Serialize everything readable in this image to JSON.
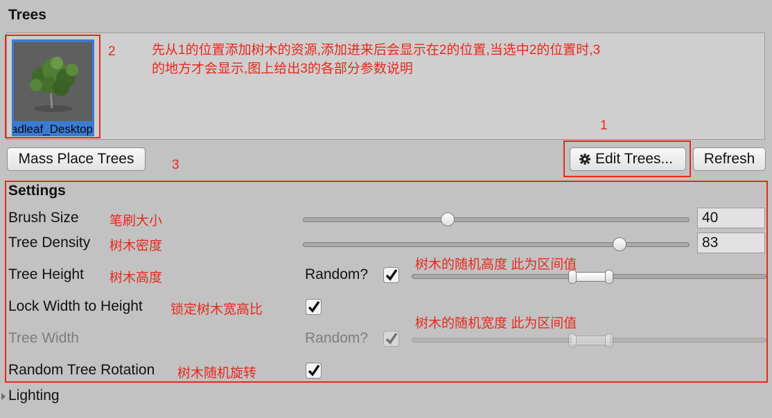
{
  "header": {
    "title": "Trees"
  },
  "tree_list": {
    "items": [
      {
        "name": "Broadleaf_Desktop",
        "selected": true,
        "icon": "tree-thumbnail"
      }
    ]
  },
  "buttons": {
    "mass_place": "Mass Place Trees",
    "edit_trees": "Edit Trees...",
    "edit_trees_icon": "gear-icon",
    "refresh": "Refresh"
  },
  "settings": {
    "title": "Settings",
    "brush_size": {
      "label": "Brush Size",
      "value": "40",
      "fraction": 0.37
    },
    "tree_density": {
      "label": "Tree Density",
      "value": "83",
      "fraction": 0.83
    },
    "tree_height": {
      "label": "Tree Height",
      "random_label": "Random?",
      "random_checked": true,
      "range": [
        0.45,
        0.56
      ]
    },
    "lock_width": {
      "label": "Lock Width to Height",
      "checked": true
    },
    "tree_width": {
      "label": "Tree Width",
      "random_label": "Random?",
      "random_checked": true,
      "disabled": true,
      "range": [
        0.45,
        0.56
      ]
    },
    "random_rotation": {
      "label": "Random Tree Rotation",
      "checked": true
    }
  },
  "lighting": {
    "label": "Lighting"
  },
  "annotations": {
    "marker_1": "1",
    "marker_2": "2",
    "marker_3": "3",
    "top_note_line1": "先从1的位置添加树木的资源,添加进来后会显示在2的位置,当选中2的位置时,3",
    "top_note_line2": "的地方才会显示,图上给出3的各部分参数说明",
    "brush_size": "笔刷大小",
    "tree_density": "树木密度",
    "tree_height": "树木高度",
    "height_range_note": "树木的随机高度 此为区间值",
    "lock_width": "锁定树木宽高比",
    "width_range_note": "树木的随机宽度 此为区间值",
    "random_rotation": "树木随机旋转"
  },
  "colors": {
    "annotation_red": "#e8281c",
    "selection_blue": "#3b7bd4",
    "panel_bg": "#c2c2c2"
  }
}
